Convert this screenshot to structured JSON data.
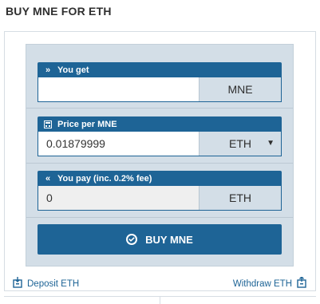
{
  "title": "BUY MNE FOR ETH",
  "you_get": {
    "label": "You get",
    "icon": "double-chevron-right-icon",
    "value": "",
    "unit": "MNE"
  },
  "price": {
    "label": "Price per MNE",
    "icon": "calculator-icon",
    "value": "0.01879999",
    "unit": "ETH",
    "dropdown": true
  },
  "you_pay": {
    "label": "You pay (inc. 0.2% fee)",
    "icon": "double-chevron-left-icon",
    "value": "0",
    "unit": "ETH"
  },
  "buy_button": {
    "label": "BUY MNE",
    "icon": "check-circle-icon"
  },
  "footer": {
    "deposit": "Deposit ETH",
    "withdraw": "Withdraw ETH"
  },
  "colors": {
    "accent": "#1e6496",
    "panel": "#d3dee7"
  }
}
